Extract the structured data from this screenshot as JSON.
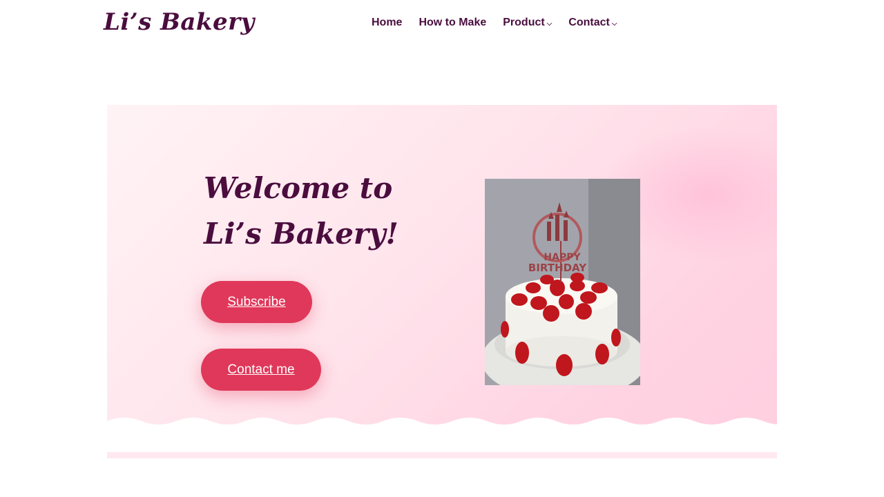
{
  "header": {
    "logo": "Li’s Bakery",
    "nav": [
      {
        "label": "Home",
        "dropdown": false
      },
      {
        "label": "How to Make",
        "dropdown": false
      },
      {
        "label": "Product",
        "dropdown": true
      },
      {
        "label": "Contact",
        "dropdown": true
      }
    ]
  },
  "hero": {
    "title": "Welcome to Li’s Bakery!",
    "subscribe_label": "Subscribe",
    "contact_label": "Contact me",
    "image": {
      "topper_line1": "HAPPY",
      "topper_line2": "BIRTHDAY"
    }
  },
  "colors": {
    "brand": "#4a0d3e",
    "button": "#e0385a",
    "hero_bg": "#ffe4ec"
  }
}
